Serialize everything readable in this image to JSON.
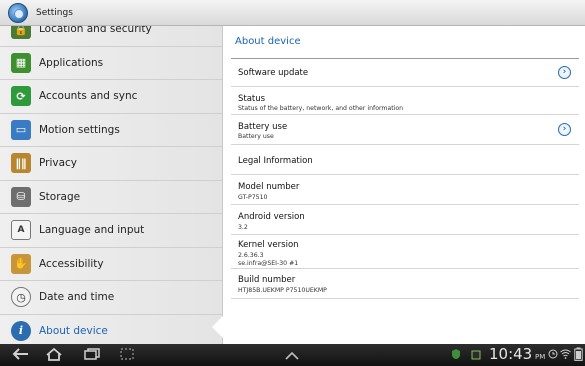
{
  "window": {
    "title": "Settings"
  },
  "sidebar": {
    "items": [
      {
        "label": "Location and security",
        "icon": "lock-icon",
        "color": "#4a7a35"
      },
      {
        "label": "Applications",
        "icon": "applications-icon",
        "color": "#3d8f2f"
      },
      {
        "label": "Accounts and sync",
        "icon": "sync-icon",
        "color": "#2e9a3a"
      },
      {
        "label": "Motion settings",
        "icon": "motion-icon",
        "color": "#3a7cc4"
      },
      {
        "label": "Privacy",
        "icon": "fence-icon",
        "color": "#b8862f"
      },
      {
        "label": "Storage",
        "icon": "storage-icon",
        "color": "#6e6e6e"
      },
      {
        "label": "Language and input",
        "icon": "keyboard-icon",
        "color": "#7b7b7b"
      },
      {
        "label": "Accessibility",
        "icon": "hand-icon",
        "color": "#c8963a"
      },
      {
        "label": "Date and time",
        "icon": "clock-icon",
        "color": "#8d8d8d"
      },
      {
        "label": "About device",
        "icon": "info-icon",
        "color": "#2c6db0"
      }
    ],
    "selected_index": 9
  },
  "detail": {
    "title": "About device",
    "rows": [
      {
        "title": "Software update",
        "subtitle": "",
        "chevron": true
      },
      {
        "title": "Status",
        "subtitle": "Status of the battery, network, and other information",
        "chevron": false
      },
      {
        "title": "Battery use",
        "subtitle": "Battery use",
        "chevron": true
      },
      {
        "title": "Legal Information",
        "subtitle": "",
        "chevron": false
      },
      {
        "title": "Model number",
        "subtitle": "GT-P7510",
        "chevron": false
      },
      {
        "title": "Android version",
        "subtitle": "3.2",
        "chevron": false
      },
      {
        "title": "Kernel version",
        "subtitle": "2.6.36.3\nse.infra@SEI-30 #1",
        "chevron": false
      },
      {
        "title": "Build number",
        "subtitle": "HTJ85B.UEKMP P7510UEKMP",
        "chevron": false
      }
    ]
  },
  "navbar": {
    "back_icon": "back-arrow-icon",
    "home_icon": "home-icon",
    "recent_icon": "recent-apps-icon",
    "screenshot_icon": "screenshot-icon",
    "up_icon": "chevron-up-icon",
    "time": "10:43",
    "time_suffix": "PM"
  },
  "colors": {
    "accent": "#1a63b5",
    "navbar": "#1a1a1a"
  }
}
